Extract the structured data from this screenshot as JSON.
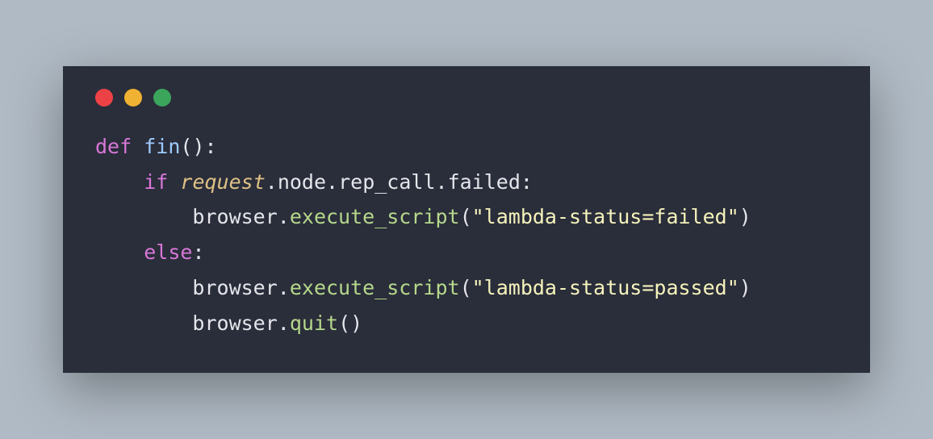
{
  "window": {
    "controls": {
      "close": "close",
      "minimize": "minimize",
      "maximize": "maximize"
    }
  },
  "code": {
    "kw_def": "def",
    "fn_fin": "fin",
    "paren_open": "(",
    "paren_close": ")",
    "colon": ":",
    "kw_if": "if",
    "arg_request": "request",
    "dot": ".",
    "attr_node": "node",
    "attr_rep_call": "rep_call",
    "attr_failed": "failed",
    "ident_browser": "browser",
    "method_execute_script": "execute_script",
    "str_failed": "\"lambda-status=failed\"",
    "kw_else": "else",
    "str_passed": "\"lambda-status=passed\"",
    "method_quit": "quit",
    "indent1": "    ",
    "indent2": "        "
  }
}
